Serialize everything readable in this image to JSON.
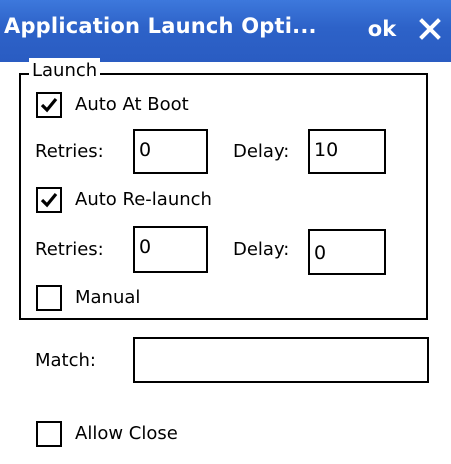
{
  "window": {
    "title": "Application Launch Opti...",
    "ok_label": "ok",
    "close_icon": "close-icon",
    "colors": {
      "titlebar": "#2d62c8",
      "title_text": "#ffffff"
    }
  },
  "launch_group": {
    "label": "Launch",
    "auto_at_boot": {
      "label": "Auto At Boot",
      "checked": true
    },
    "boot_retries": {
      "label": "Retries:",
      "value": "0"
    },
    "boot_delay": {
      "label": "Delay:",
      "value": "10"
    },
    "auto_relaunch": {
      "label": "Auto Re-launch",
      "checked": true
    },
    "relaunch_retries": {
      "label": "Retries:",
      "value": "0"
    },
    "relaunch_delay": {
      "label": "Delay:",
      "value": "0"
    },
    "manual": {
      "label": "Manual",
      "checked": false
    }
  },
  "match": {
    "label": "Match:",
    "value": ""
  },
  "allow_close": {
    "label": "Allow Close",
    "checked": false
  }
}
